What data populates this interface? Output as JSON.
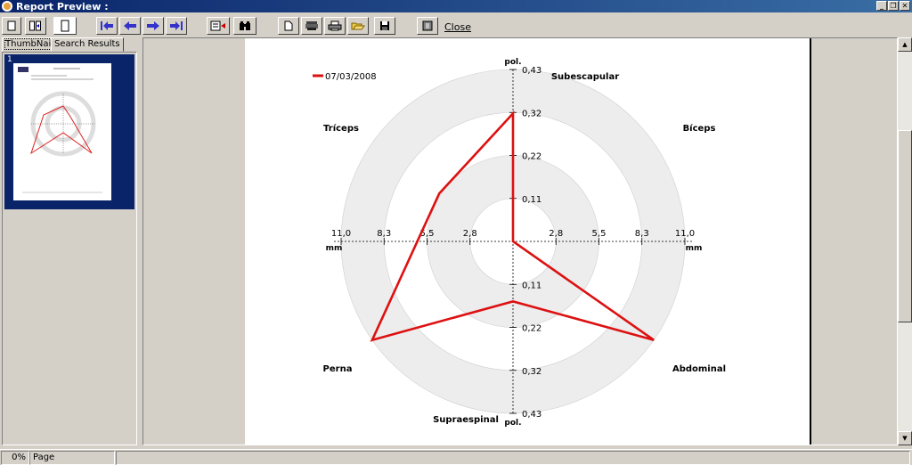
{
  "window": {
    "title": "Report Preview :",
    "controls": [
      "minimize",
      "restore",
      "close"
    ]
  },
  "toolbar": {
    "close_label": "Close",
    "buttons": [
      "one-page-icon",
      "two-pages-icon",
      "page-width-icon",
      "first-page-icon",
      "previous-page-icon",
      "next-page-icon",
      "last-page-icon",
      "go-to-page-icon",
      "search-icon",
      "new-page-icon",
      "printer-setup-icon",
      "print-icon",
      "open-icon",
      "save-icon",
      "exit-icon"
    ]
  },
  "tabs": {
    "thumbnails": "ThumbNails",
    "search_results": "Search Results"
  },
  "thumbnail": {
    "page_number": "1"
  },
  "status": {
    "progress": "0%",
    "page_label": "Page"
  },
  "chart_data": {
    "type": "radar",
    "legend": [
      {
        "name": "07/03/2008",
        "color": "#dd1111"
      }
    ],
    "legend_position": "top-left",
    "unit_horizontal": "mm",
    "unit_vertical": "pol.",
    "horizontal_ticks": [
      "11,0",
      "8,3",
      "5,5",
      "2,8",
      "2,8",
      "5,5",
      "8,3",
      "11,0"
    ],
    "vertical_ticks_top": [
      "0,43",
      "0,32",
      "0,22",
      "0,11"
    ],
    "vertical_ticks_bottom": [
      "0,11",
      "0,22",
      "0,32",
      "0,43"
    ],
    "axes": [
      "Subescapular",
      "Bíceps",
      "Abdominal",
      "Supraespinal",
      "Perna",
      "Tríceps"
    ],
    "max": 0.43,
    "series": [
      {
        "name": "07/03/2008",
        "values": {
          "Subescapular": 0.32,
          "Bíceps": 0.0,
          "Abdominal": 0.43,
          "Supraespinal": 0.15,
          "Perna": 0.43,
          "Tríceps": 0.22
        }
      }
    ]
  }
}
